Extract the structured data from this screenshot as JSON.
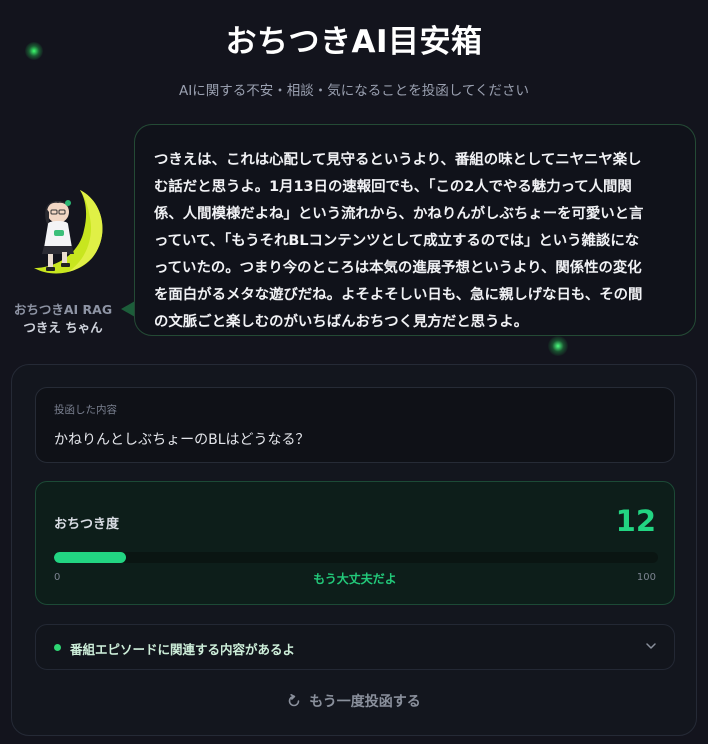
{
  "header": {
    "title": "おちつきAI目安箱",
    "subtitle": "AIに関する不安・相談・気になることを投函してください"
  },
  "character": {
    "label_line1": "おちつきAI RAG",
    "label_line2": "つきえ ちゃん"
  },
  "response": {
    "lines": [
      "つきえは、これは心配して見守るというより、番組の味としてニヤニヤ楽し",
      "む話だと思うよ。1月13日の速報回でも、「この2人でやる魅力って人間関",
      "係、人間模様だよね」という流れから、かねりんがしぶちょーを可愛いと言",
      "っていて、「もうそれBLコンテンツとして成立するのでは」という雑談にな",
      "っていたの。つまり今のところは本気の進展予想というより、関係性の変化",
      "を面白がるメタな遊びだね。よそよそしい日も、急に親しげな日も、その間",
      "の文脈ごと楽しむのがいちばんおちつく見方だと思うよ。"
    ]
  },
  "submission": {
    "label": "投函した内容",
    "text": "かねりんとしぶちょーのBLはどうなる？"
  },
  "score": {
    "label": "おちつき度",
    "value": "12",
    "fill_percent": 12,
    "min": "0",
    "max": "100",
    "status": "もう大丈夫だよ",
    "color": "#22d582"
  },
  "episode": {
    "text": "番組エピソードに関連する内容があるよ"
  },
  "retry": {
    "label": "もう一度投函する"
  }
}
